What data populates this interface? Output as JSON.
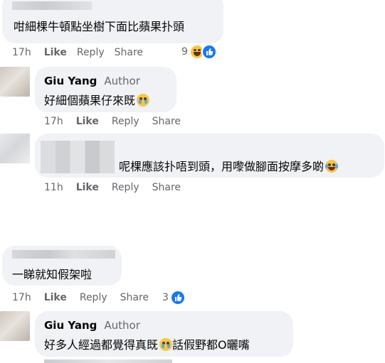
{
  "colors": {
    "bubble": "#f0f2f5",
    "meta": "#65676b",
    "text": "#050505",
    "like_blue": "#1877f2"
  },
  "comment1": {
    "text": "咁細棵牛頓點坐樹下面比蘋果扑頭",
    "time": "17h",
    "like": "Like",
    "reply": "Reply",
    "share": "Share",
    "reaction_count": "9"
  },
  "reply1": {
    "name": "Giu Yang",
    "badge": "Author",
    "text": "好細個蘋果仔來既",
    "time": "17h",
    "like": "Like",
    "reply": "Reply",
    "share": "Share"
  },
  "comment2": {
    "text": "呢棵應該扑唔到頭，用嚟做腳面按摩多啲",
    "time": "11h",
    "like": "Like",
    "reply": "Reply",
    "share": "Share"
  },
  "comment3": {
    "text": "一睇就知假架啦",
    "time": "17h",
    "like": "Like",
    "reply": "Reply",
    "share": "Share",
    "reaction_count": "3"
  },
  "reply2": {
    "name": "Giu Yang",
    "badge": "Author",
    "text_a": "好多人經過都覺得真既",
    "text_b": "話假野都O曬嘴"
  },
  "icons": [
    "laugh-reaction-icon",
    "like-reaction-icon",
    "pleading-face-emoji-icon",
    "laughing-tears-emoji-icon"
  ]
}
